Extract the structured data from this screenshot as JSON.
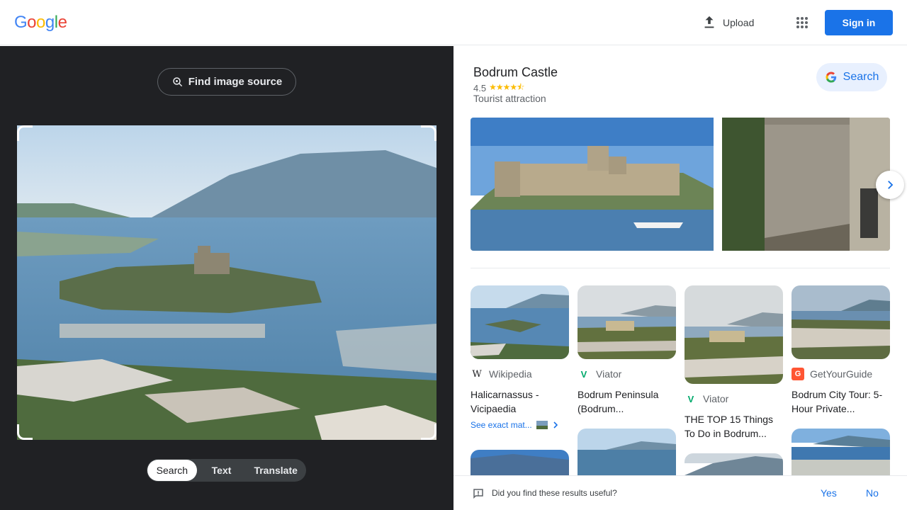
{
  "header": {
    "logo_letters": [
      {
        "char": "G",
        "color": "#4285f4"
      },
      {
        "char": "o",
        "color": "#ea4335"
      },
      {
        "char": "o",
        "color": "#fbbc05"
      },
      {
        "char": "g",
        "color": "#4285f4"
      },
      {
        "char": "l",
        "color": "#34a853"
      },
      {
        "char": "e",
        "color": "#ea4335"
      }
    ],
    "upload_label": "Upload",
    "upload_icon": "upload-icon",
    "apps_icon": "apps-grid-icon",
    "signin_label": "Sign in",
    "accent_color": "#1a73e8"
  },
  "left": {
    "find_source_label": "Find image source",
    "find_source_icon": "lens-search-icon",
    "tabs": [
      {
        "label": "Search",
        "active": true
      },
      {
        "label": "Text",
        "active": false
      },
      {
        "label": "Translate",
        "active": false
      }
    ]
  },
  "knowledge_panel": {
    "title": "Bodrum Castle",
    "rating": "4.5",
    "stars": "★★★★⯪",
    "type": "Tourist attraction",
    "search_label": "Search",
    "next_icon": "chevron-right-icon"
  },
  "results": [
    {
      "source": "Wikipedia",
      "favicon": "W",
      "title": "Halicarnassus - Vicipaedia",
      "exact_label": "See exact mat..."
    },
    {
      "source": "Viator",
      "favicon": "V",
      "title": "Bodrum Peninsula (Bodrum..."
    },
    {
      "source": "Viator",
      "favicon": "V",
      "title": "THE TOP 15 Things To Do in Bodrum..."
    },
    {
      "source": "GetYourGuide",
      "favicon": "G",
      "title": "Bodrum City Tour: 5-Hour Private..."
    }
  ],
  "feedback": {
    "question": "Did you find these results useful?",
    "yes_label": "Yes",
    "no_label": "No"
  }
}
